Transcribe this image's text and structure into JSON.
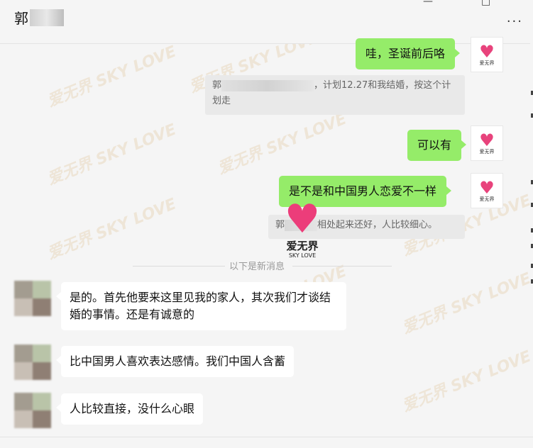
{
  "header": {
    "title": "郭",
    "more_label": "···",
    "minimize": "—",
    "maximize": "□"
  },
  "messages": {
    "m1": "哇，圣诞前后咯",
    "q1_prefix": "郭",
    "q1_text": "，计划12.27和我结婚，按这个计划走",
    "m2": "可以有",
    "m3": "是不是和中国男人恋爱不一样",
    "q2_prefix": "郭",
    "q2_text": "相处起来还好，人比较细心。",
    "separator": "以下是新消息",
    "m4": "是的。首先他要来这里见我的家人，其次我们才谈结婚的事情。还是有诚意的",
    "m5": "比中国男人喜欢表达感情。我们中国人含蓄",
    "m6": "人比较直接，没什么心眼"
  },
  "branding": {
    "avatar_brand": "爱无界",
    "logo_cn": "爱无界",
    "logo_en": "SKY LOVE",
    "watermark": "爱无界 SKY LOVE",
    "accent": "#ec3d7a"
  }
}
